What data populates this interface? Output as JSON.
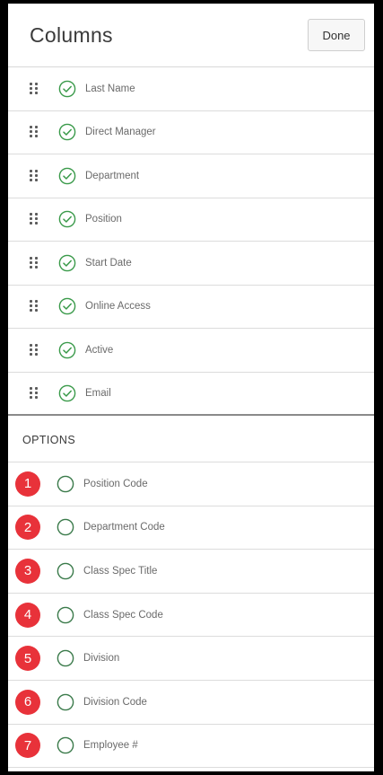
{
  "header": {
    "title": "Columns",
    "done_label": "Done"
  },
  "columns": [
    {
      "label": "Last Name",
      "checked": true
    },
    {
      "label": "Direct Manager",
      "checked": true
    },
    {
      "label": "Department",
      "checked": true
    },
    {
      "label": "Position",
      "checked": true
    },
    {
      "label": "Start Date",
      "checked": true
    },
    {
      "label": "Online Access",
      "checked": true
    },
    {
      "label": "Active",
      "checked": true
    },
    {
      "label": "Email",
      "checked": true
    }
  ],
  "options": {
    "heading": "OPTIONS",
    "items": [
      {
        "badge": "1",
        "label": "Position Code",
        "checked": false
      },
      {
        "badge": "2",
        "label": "Department Code",
        "checked": false
      },
      {
        "badge": "3",
        "label": "Class Spec Title",
        "checked": false
      },
      {
        "badge": "4",
        "label": "Class Spec Code",
        "checked": false
      },
      {
        "badge": "5",
        "label": "Division",
        "checked": false
      },
      {
        "badge": "6",
        "label": "Division Code",
        "checked": false
      },
      {
        "badge": "7",
        "label": "Employee #",
        "checked": false
      }
    ]
  },
  "colors": {
    "check_green": "#3a9a4a",
    "badge_red": "#e8323a",
    "radio_green": "#3a7a4a"
  },
  "icons": {
    "drag": "drag-handle-icon",
    "check": "check-circle-icon",
    "radio": "empty-circle-icon"
  }
}
